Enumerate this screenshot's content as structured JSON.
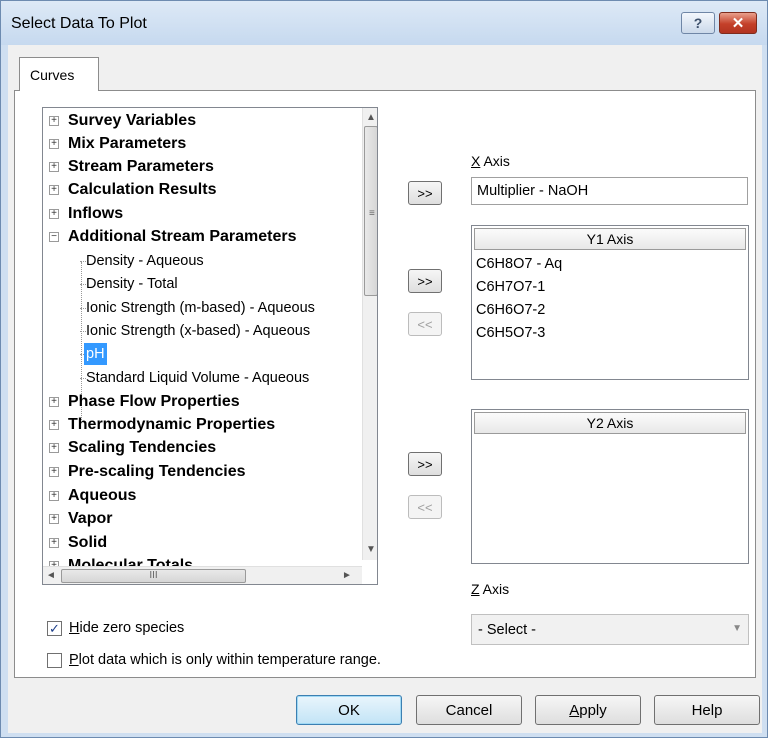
{
  "window": {
    "title": "Select Data To Plot",
    "help_button": "?",
    "close_button": "✕"
  },
  "tabs": [
    {
      "label": "Curves"
    }
  ],
  "tree": {
    "items": [
      {
        "label": "Survey Variables",
        "level": 0,
        "expanded": false
      },
      {
        "label": "Mix Parameters",
        "level": 0,
        "expanded": false
      },
      {
        "label": "Stream Parameters",
        "level": 0,
        "expanded": false
      },
      {
        "label": "Calculation Results",
        "level": 0,
        "expanded": false
      },
      {
        "label": "Inflows",
        "level": 0,
        "expanded": false
      },
      {
        "label": "Additional Stream Parameters",
        "level": 0,
        "expanded": true
      },
      {
        "label": "Density - Aqueous",
        "level": 1
      },
      {
        "label": "Density - Total",
        "level": 1
      },
      {
        "label": "Ionic Strength (m-based) - Aqueous",
        "level": 1
      },
      {
        "label": "Ionic Strength (x-based) - Aqueous",
        "level": 1
      },
      {
        "label": "pH",
        "level": 1,
        "selected": true
      },
      {
        "label": "Standard Liquid Volume - Aqueous",
        "level": 1
      },
      {
        "label": "Phase Flow Properties",
        "level": 0,
        "expanded": false
      },
      {
        "label": "Thermodynamic Properties",
        "level": 0,
        "expanded": false
      },
      {
        "label": "Scaling Tendencies",
        "level": 0,
        "expanded": false
      },
      {
        "label": "Pre-scaling Tendencies",
        "level": 0,
        "expanded": false
      },
      {
        "label": "Aqueous",
        "level": 0,
        "expanded": false
      },
      {
        "label": "Vapor",
        "level": 0,
        "expanded": false
      },
      {
        "label": "Solid",
        "level": 0,
        "expanded": false
      },
      {
        "label": "Molecular Totals",
        "level": 0,
        "expanded": false
      }
    ],
    "expand_glyph": "+",
    "collapse_glyph": "−",
    "scroll_up": "▲",
    "scroll_down": "▼",
    "scroll_left": "◄",
    "scroll_right": "►",
    "vgrip": "≡",
    "hgrip": "III"
  },
  "move_buttons": {
    "add": ">>",
    "remove": "<<"
  },
  "x_axis": {
    "label_underlined": "X",
    "label_rest": " Axis",
    "value": "Multiplier - NaOH"
  },
  "y1_axis": {
    "header": "Y1 Axis",
    "items": [
      "C6H8O7 - Aq",
      "C6H7O7-1",
      "C6H6O7-2",
      "C6H5O7-3"
    ]
  },
  "y2_axis": {
    "header": "Y2 Axis",
    "items": []
  },
  "z_axis": {
    "label_underlined": "Z",
    "label_rest": "  Axis",
    "selected": "- Select -",
    "arrow": "▼"
  },
  "options": {
    "hide_zero": {
      "label_underlined": "H",
      "label_rest": "ide zero species",
      "checked": true,
      "mark": "✓"
    },
    "temp_range": {
      "label_underlined": "P",
      "label_rest": "lot data which is only within temperature range.",
      "checked": false
    }
  },
  "buttons": {
    "ok": "OK",
    "cancel": "Cancel",
    "apply_underlined": "A",
    "apply_rest": "pply",
    "help": "Help"
  }
}
